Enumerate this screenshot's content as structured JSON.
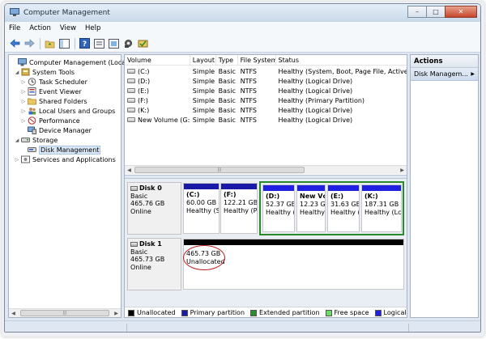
{
  "window": {
    "title": "Computer Management",
    "min": "–",
    "max": "□",
    "close": "✕"
  },
  "menu": [
    "File",
    "Action",
    "View",
    "Help"
  ],
  "toolbar_icons": [
    "back-arrow-icon",
    "forward-arrow-icon",
    "up-folder-icon",
    "console-tree-icon",
    "help-icon",
    "properties-icon",
    "connect-icon",
    "settings-icon",
    "check-disk-icon"
  ],
  "tree": {
    "items": [
      {
        "label": "Computer Management (Local",
        "level": 0,
        "expander": "",
        "icon": "computer-icon"
      },
      {
        "label": "System Tools",
        "level": 1,
        "expander": "◢",
        "icon": "tools-icon"
      },
      {
        "label": "Task Scheduler",
        "level": 2,
        "expander": "▷",
        "icon": "clock-icon"
      },
      {
        "label": "Event Viewer",
        "level": 2,
        "expander": "▷",
        "icon": "event-viewer-icon"
      },
      {
        "label": "Shared Folders",
        "level": 2,
        "expander": "▷",
        "icon": "shared-folder-icon"
      },
      {
        "label": "Local Users and Groups",
        "level": 2,
        "expander": "▷",
        "icon": "users-icon"
      },
      {
        "label": "Performance",
        "level": 2,
        "expander": "▷",
        "icon": "performance-icon"
      },
      {
        "label": "Device Manager",
        "level": 2,
        "expander": "",
        "icon": "device-manager-icon"
      },
      {
        "label": "Storage",
        "level": 1,
        "expander": "◢",
        "icon": "storage-icon"
      },
      {
        "label": "Disk Management",
        "level": 2,
        "expander": "",
        "icon": "disk-management-icon",
        "selected": true
      },
      {
        "label": "Services and Applications",
        "level": 1,
        "expander": "▷",
        "icon": "services-icon"
      }
    ]
  },
  "volumes": {
    "headers": [
      "Volume",
      "Layout",
      "Type",
      "File System",
      "Status"
    ],
    "rows": [
      [
        "(C:)",
        "Simple",
        "Basic",
        "NTFS",
        "Healthy (System, Boot, Page File, Active, Cra"
      ],
      [
        "(D:)",
        "Simple",
        "Basic",
        "NTFS",
        "Healthy (Logical Drive)"
      ],
      [
        "(E:)",
        "Simple",
        "Basic",
        "NTFS",
        "Healthy (Logical Drive)"
      ],
      [
        "(F:)",
        "Simple",
        "Basic",
        "NTFS",
        "Healthy (Primary Partition)"
      ],
      [
        "(K:)",
        "Simple",
        "Basic",
        "NTFS",
        "Healthy (Logical Drive)"
      ],
      [
        "New Volume (G:)",
        "Simple",
        "Basic",
        "NTFS",
        "Healthy (Logical Drive)"
      ]
    ]
  },
  "disks": [
    {
      "name": "Disk 0",
      "type": "Basic",
      "size": "465.76 GB",
      "state": "Online",
      "partitions": [
        {
          "name": "(C:)",
          "size": "60.00 GB I",
          "status": "Healthy (S",
          "kind": "primary"
        },
        {
          "name": "(F:)",
          "size": "122.21 GB",
          "status": "Healthy (P",
          "kind": "primary"
        },
        {
          "name": "(D:)",
          "size": "52.37 GB",
          "status": "Healthy (",
          "kind": "logical"
        },
        {
          "name": "New Vc",
          "size": "12.23 GB",
          "status": "Healthy",
          "kind": "logical"
        },
        {
          "name": "(E:)",
          "size": "31.63 GB",
          "status": "Healthy (",
          "kind": "logical"
        },
        {
          "name": "(K:)",
          "size": "187.31 GB",
          "status": "Healthy (Lc",
          "kind": "logical"
        }
      ]
    },
    {
      "name": "Disk 1",
      "type": "Basic",
      "size": "465.73 GB",
      "state": "Online",
      "partitions": [
        {
          "name": "",
          "size": "465.73 GB",
          "status": "Unallocated",
          "kind": "unallocated"
        }
      ]
    }
  ],
  "legend": [
    {
      "label": "Unallocated",
      "color": "#000000"
    },
    {
      "label": "Primary partition",
      "color": "#1a1aa8"
    },
    {
      "label": "Extended partition",
      "color": "#2e8b2e"
    },
    {
      "label": "Free space",
      "color": "#66e066"
    },
    {
      "label": "Logical drive",
      "color": "#2020e0"
    }
  ],
  "actions": {
    "title": "Actions",
    "items": [
      {
        "label": "Disk Managem...",
        "arrow": "▶"
      }
    ]
  },
  "colors": {
    "accent": "#1e4fb0",
    "annotation": "#c21d1d",
    "extended": "#2a8a2a"
  }
}
